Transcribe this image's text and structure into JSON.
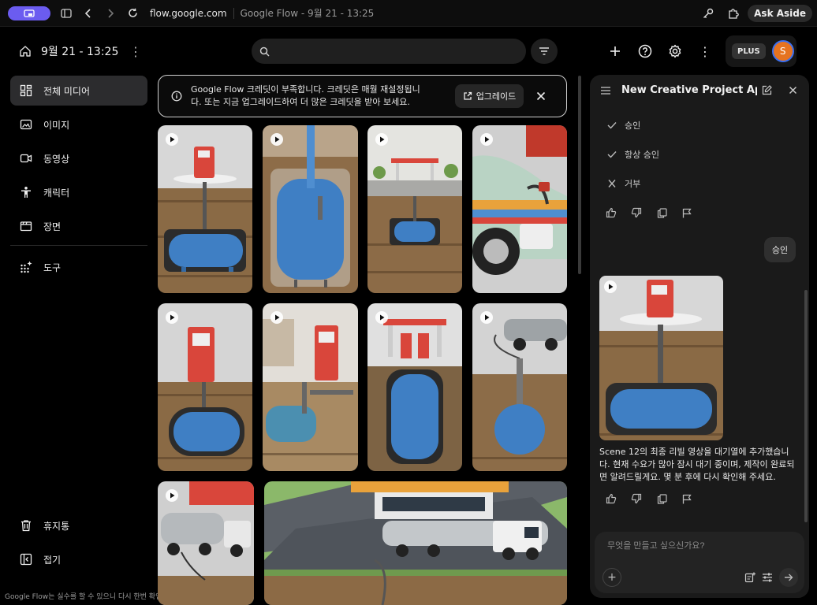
{
  "browser": {
    "url": "flow.google.com",
    "tab_title": "Google Flow - 9월 21 - 13:25",
    "ask_aside": "Ask Aside"
  },
  "sidebar": {
    "project_date": "9월 21 - 13:25",
    "items": [
      {
        "label": "전체 미디어",
        "icon": "grid-icon",
        "active": true
      },
      {
        "label": "이미지",
        "icon": "image-icon"
      },
      {
        "label": "동영상",
        "icon": "video-icon"
      },
      {
        "label": "캐릭터",
        "icon": "person-icon"
      },
      {
        "label": "장면",
        "icon": "scene-icon"
      }
    ],
    "tools": {
      "label": "도구",
      "icon": "sparkle-grid-icon"
    },
    "bottom": [
      {
        "label": "휴지통",
        "icon": "trash-icon"
      },
      {
        "label": "접기",
        "icon": "collapse-icon"
      }
    ],
    "footer_note": "Google Flow는 실수를 할 수 있으니 다시 한번 확인하세요"
  },
  "search": {
    "value": "",
    "placeholder": ""
  },
  "account": {
    "plan": "PLUS",
    "avatar_initial": "S"
  },
  "banner": {
    "text": "Google Flow 크레딧이 부족합니다. 크레딧은 매월 재설정됩니다. 또는 지금 업그레이드하여 더 많은 크레딧을 받아 보세요.",
    "upgrade_label": "업그레이드"
  },
  "panel": {
    "title": "New Creative Project App...",
    "options": [
      {
        "label": "승인",
        "icon": "check-icon"
      },
      {
        "label": "항상 승인",
        "icon": "check-icon"
      },
      {
        "label": "거부",
        "icon": "x-icon"
      }
    ],
    "user_message": "승인",
    "reply": "Scene 12의 최종 리빌 영상을 대기열에 추가했습니다. 현재 수요가 많아 잠시 대기 중이며, 제작이 완료되면 알려드릴게요. 몇 분 후에 다시 확인해 주세요.",
    "composer_placeholder": "무엇을 만들고 싶으신가요?"
  },
  "colors": {
    "accent": "#6b5cf0",
    "avatar": "#e67320",
    "avatar_ring": "#3a6ff0",
    "tank_blue": "#3f7fc4",
    "soil": "#8a6a45"
  }
}
